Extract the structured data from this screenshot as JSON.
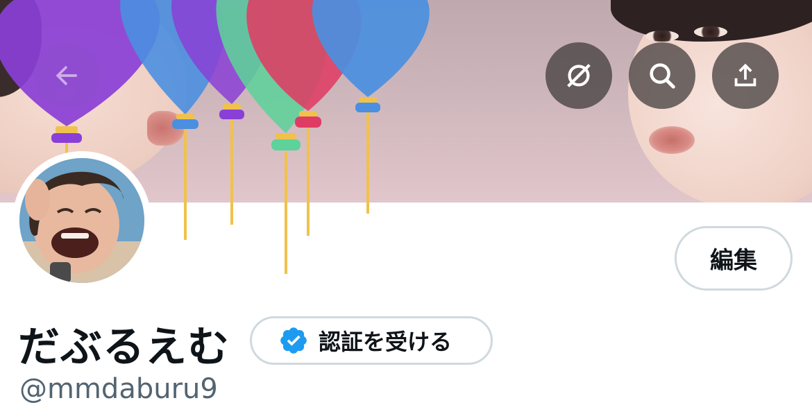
{
  "header": {
    "back_icon": "arrow-left-icon",
    "actions": [
      {
        "icon": "no-alt-text-icon"
      },
      {
        "icon": "search-icon"
      },
      {
        "icon": "share-icon"
      }
    ]
  },
  "profile": {
    "edit_label": "編集",
    "display_name": "だぶるえむ",
    "verify_label": "認証を受ける",
    "handle": "@mmdaburu9"
  },
  "colors": {
    "verified_badge": "#1d9bf0",
    "button_border": "#cfd9de",
    "text_primary": "#0f1419",
    "text_secondary": "#536471"
  }
}
